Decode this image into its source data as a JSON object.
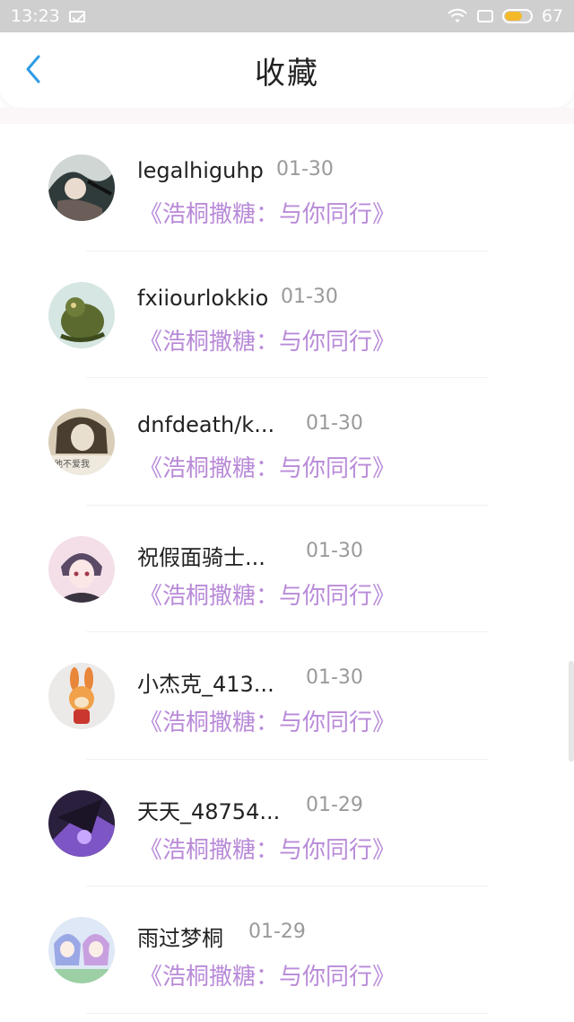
{
  "status_bar": {
    "time": "13:23",
    "battery_level": "67",
    "battery_fill_fraction": 0.67,
    "icons": [
      "mail-icon",
      "wifi-icon",
      "sim-icon",
      "battery-icon"
    ]
  },
  "header": {
    "title": "收藏",
    "back_icon": "chevron-left-icon",
    "accent_color": "#2e9be6"
  },
  "list": {
    "subtitle_color": "#b98bd8",
    "items": [
      {
        "name": "legalhiguhp",
        "date": "01-30",
        "subtitle": "《浩桐撒糖：与你同行》",
        "avatar": "avatar-dark-art"
      },
      {
        "name": "fxiiourlokkio",
        "date": "01-30",
        "subtitle": "《浩桐撒糖：与你同行》",
        "avatar": "avatar-dragon"
      },
      {
        "name": "dnfdeath/k...",
        "date": "01-30",
        "subtitle": "《浩桐撒糖：与你同行》",
        "avatar": "avatar-girl-sepia"
      },
      {
        "name": "祝假面骑士...",
        "date": "01-30",
        "subtitle": "《浩桐撒糖：与你同行》",
        "avatar": "avatar-anime-boy"
      },
      {
        "name": "小杰克_413...",
        "date": "01-30",
        "subtitle": "《浩桐撒糖：与你同行》",
        "avatar": "avatar-rabbit"
      },
      {
        "name": "天天_48754...",
        "date": "01-29",
        "subtitle": "《浩桐撒糖：与你同行》",
        "avatar": "avatar-purple-art"
      },
      {
        "name": "雨过梦桐",
        "date": "01-29",
        "subtitle": "《浩桐撒糖：与你同行》",
        "avatar": "avatar-anime-girls"
      }
    ]
  }
}
